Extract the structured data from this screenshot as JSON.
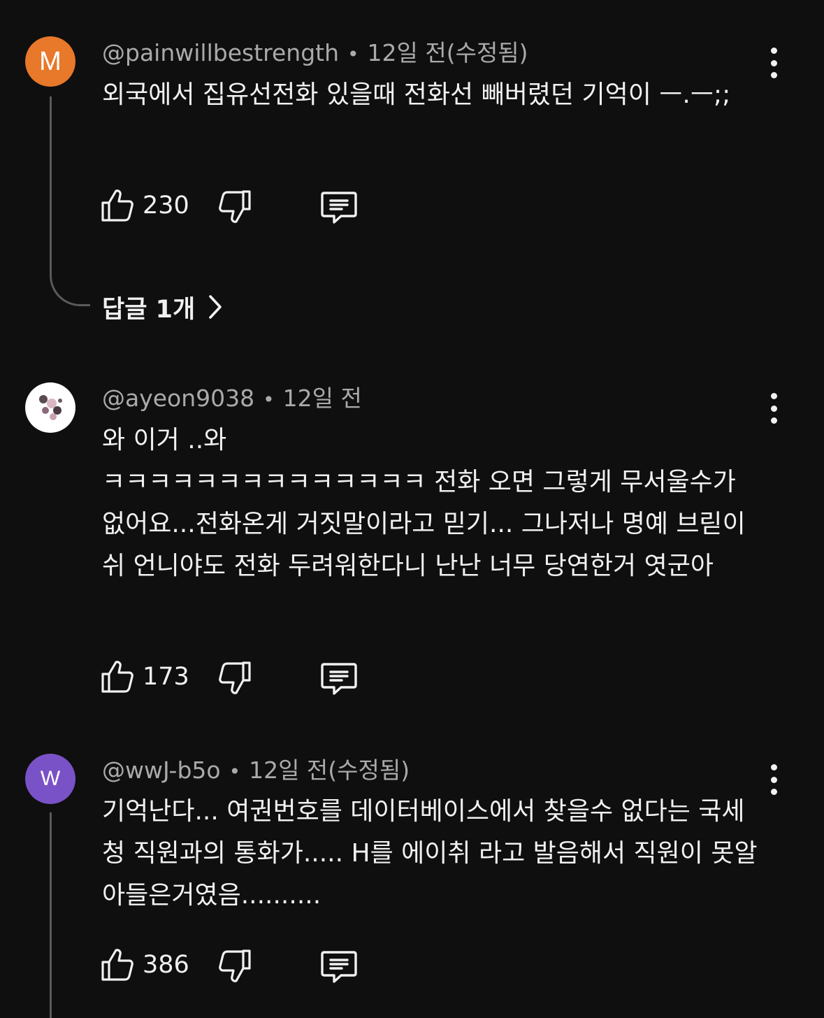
{
  "comments": [
    {
      "avatar_letter": "M",
      "avatar_color": "#e8782a",
      "author": "@painwillbestrength",
      "separator": "•",
      "time": "12일 전(수정됨)",
      "text": "외국에서 집유선전화 있을때 전화선 빼버렸던 기억이 ㅡ.ㅡ;;",
      "likes": "230",
      "replies_label": "답글 1개"
    },
    {
      "avatar_image": "user-photo",
      "author": "@ayeon9038",
      "separator": "•",
      "time": "12일 전",
      "text": "와 이거 ..와\nㅋㅋㅋㅋㅋㅋㅋㅋㅋㅋㅋㅋㅋㅋ 전화 오면 그렇게 무서울수가 없어요...전화온게 거짓말이라고 믿기... 그나저나 명예 브릳이쉬 언니야도 전화 두려워한다니 난난 너무 당연한거 엿군아",
      "likes": "173"
    },
    {
      "avatar_letter": "W",
      "avatar_color": "#7a52c7",
      "author": "@wwJ-b5o",
      "separator": "•",
      "time": "12일 전(수정됨)",
      "text": "기억난다... 여권번호를 데이터베이스에서 찾을수 없다는 국세청 직원과의 통화가..... H를 에이취 라고 발음해서 직원이 못알아들은거였음..........",
      "likes": "386"
    }
  ],
  "icons": {
    "like": "thumbs-up-outline",
    "dislike": "thumbs-down-outline",
    "reply": "comment-bubble-outline",
    "more": "vertical-ellipsis",
    "chevron": "chevron-right"
  },
  "colors": {
    "background": "#0f0f0f",
    "text": "#f1f1f1",
    "meta": "#aaaaaa",
    "thread_line": "#5a5a5a"
  }
}
